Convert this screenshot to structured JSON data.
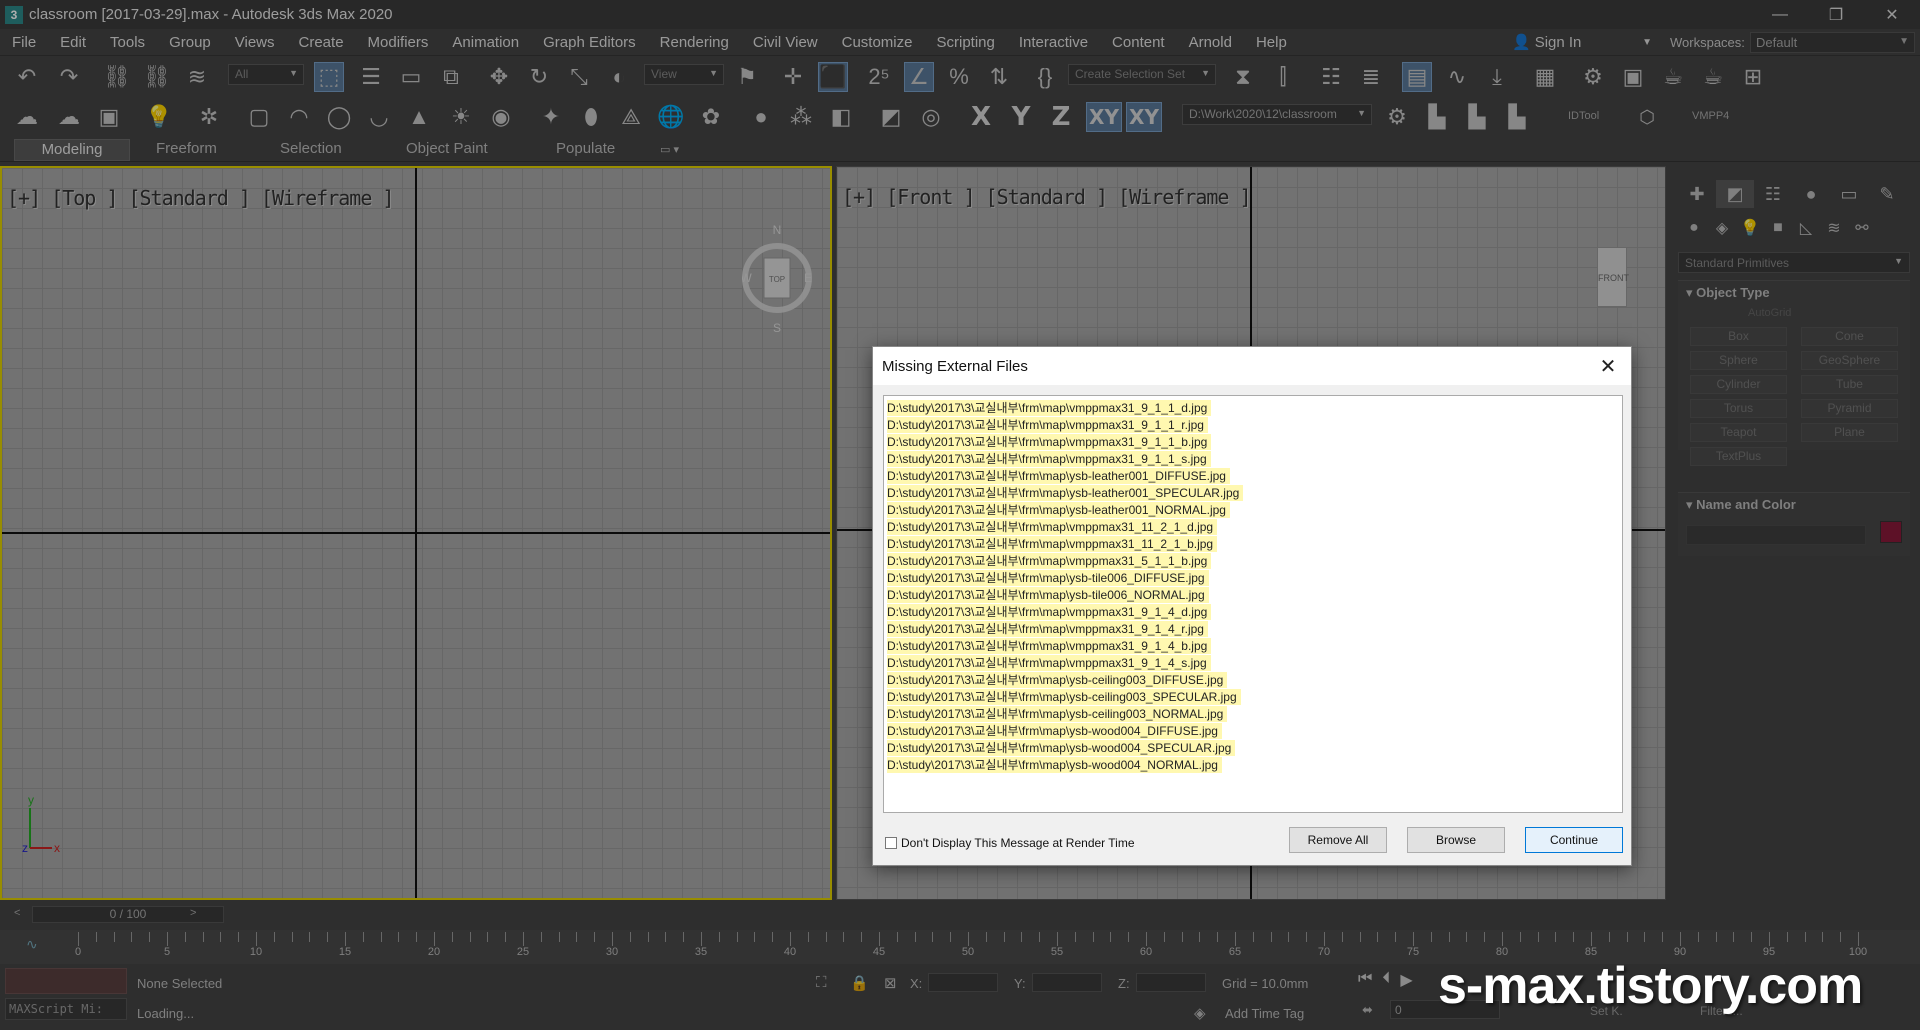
{
  "window": {
    "title": "classroom [2017-03-29].max - Autodesk 3ds Max 2020",
    "minimize": "—",
    "maximize": "❐",
    "close": "✕"
  },
  "menu": {
    "items": [
      "File",
      "Edit",
      "Tools",
      "Group",
      "Views",
      "Create",
      "Modifiers",
      "Animation",
      "Graph Editors",
      "Rendering",
      "Civil View",
      "Customize",
      "Scripting",
      "Interactive",
      "Content",
      "Arnold",
      "Help"
    ],
    "sign_in": "Sign In",
    "workspaces_label": "Workspaces:",
    "workspace_value": "Default"
  },
  "toolbar1": {
    "selection_filter": "All",
    "ref_coord": "View",
    "selection_set_placeholder": "Create Selection Set"
  },
  "toolbar2": {
    "axis_x": "X",
    "axis_y": "Y",
    "axis_z": "Z",
    "axis_xy": "XY",
    "axis_xy2": "XY",
    "path": "D:\\Work\\2020\\12\\classroom",
    "idtool": "IDTool",
    "vmpp4": "VMPP4"
  },
  "ribbon": {
    "tabs": [
      "Modeling",
      "Freeform",
      "Selection",
      "Object Paint",
      "Populate"
    ]
  },
  "viewports": {
    "top_label": "[+] [Top ] [Standard ] [Wireframe ]",
    "front_label": "[+] [Front ] [Standard ] [Wireframe ]",
    "viewcube_top": "TOP",
    "viewcube_front": "FRONT",
    "compass_n": "N",
    "compass_s": "S",
    "compass_e": "E",
    "compass_w": "W"
  },
  "command_panel": {
    "category": "Standard Primitives",
    "object_type_title": "Object Type",
    "autogrid": "AutoGrid",
    "primitives": [
      "Box",
      "Cone",
      "Sphere",
      "GeoSphere",
      "Cylinder",
      "Tube",
      "Torus",
      "Pyramid",
      "Teapot",
      "Plane",
      "TextPlus"
    ],
    "name_color_title": "Name and Color",
    "object_color": "#8a1a3a"
  },
  "timeline": {
    "slider_value": "0 / 100",
    "tick_labels": [
      "0",
      "5",
      "10",
      "15",
      "20",
      "25",
      "30",
      "35",
      "40",
      "45",
      "50",
      "55",
      "60",
      "65",
      "70",
      "75",
      "80",
      "85",
      "90",
      "95",
      "100"
    ]
  },
  "status": {
    "maxscript": "MAXScript Mi:",
    "selection": "None Selected",
    "prompt": "Loading...",
    "x_label": "X:",
    "y_label": "Y:",
    "z_label": "Z:",
    "grid": "Grid = 10.0mm",
    "add_time_tag": "Add Time Tag",
    "current_frame": "0",
    "set_k": "Set K.",
    "filters": "Filters..."
  },
  "dialog": {
    "title": "Missing External Files",
    "files": [
      "D:\\study\\2017\\3\\교실내부\\frm\\map\\vmppmax31_9_1_1_d.jpg",
      "D:\\study\\2017\\3\\교실내부\\frm\\map\\vmppmax31_9_1_1_r.jpg",
      "D:\\study\\2017\\3\\교실내부\\frm\\map\\vmppmax31_9_1_1_b.jpg",
      "D:\\study\\2017\\3\\교실내부\\frm\\map\\vmppmax31_9_1_1_s.jpg",
      "D:\\study\\2017\\3\\교실내부\\frm\\map\\ysb-leather001_DIFFUSE.jpg",
      "D:\\study\\2017\\3\\교실내부\\frm\\map\\ysb-leather001_SPECULAR.jpg",
      "D:\\study\\2017\\3\\교실내부\\frm\\map\\ysb-leather001_NORMAL.jpg",
      "D:\\study\\2017\\3\\교실내부\\frm\\map\\vmppmax31_11_2_1_d.jpg",
      "D:\\study\\2017\\3\\교실내부\\frm\\map\\vmppmax31_11_2_1_b.jpg",
      "D:\\study\\2017\\3\\교실내부\\frm\\map\\vmppmax31_5_1_1_b.jpg",
      "D:\\study\\2017\\3\\교실내부\\frm\\map\\ysb-tile006_DIFFUSE.jpg",
      "D:\\study\\2017\\3\\교실내부\\frm\\map\\ysb-tile006_NORMAL.jpg",
      "D:\\study\\2017\\3\\교실내부\\frm\\map\\vmppmax31_9_1_4_d.jpg",
      "D:\\study\\2017\\3\\교실내부\\frm\\map\\vmppmax31_9_1_4_r.jpg",
      "D:\\study\\2017\\3\\교실내부\\frm\\map\\vmppmax31_9_1_4_b.jpg",
      "D:\\study\\2017\\3\\교실내부\\frm\\map\\vmppmax31_9_1_4_s.jpg",
      "D:\\study\\2017\\3\\교실내부\\frm\\map\\ysb-ceiling003_DIFFUSE.jpg",
      "D:\\study\\2017\\3\\교실내부\\frm\\map\\ysb-ceiling003_SPECULAR.jpg",
      "D:\\study\\2017\\3\\교실내부\\frm\\map\\ysb-ceiling003_NORMAL.jpg",
      "D:\\study\\2017\\3\\교실내부\\frm\\map\\ysb-wood004_DIFFUSE.jpg",
      "D:\\study\\2017\\3\\교실내부\\frm\\map\\ysb-wood004_SPECULAR.jpg",
      "D:\\study\\2017\\3\\교실내부\\frm\\map\\ysb-wood004_NORMAL.jpg"
    ],
    "dont_display_label": "Don't Display This Message at Render Time",
    "remove_all": "Remove All",
    "browse": "Browse",
    "continue": "Continue",
    "close_glyph": "✕"
  },
  "watermark": "s-max.tistory.com"
}
